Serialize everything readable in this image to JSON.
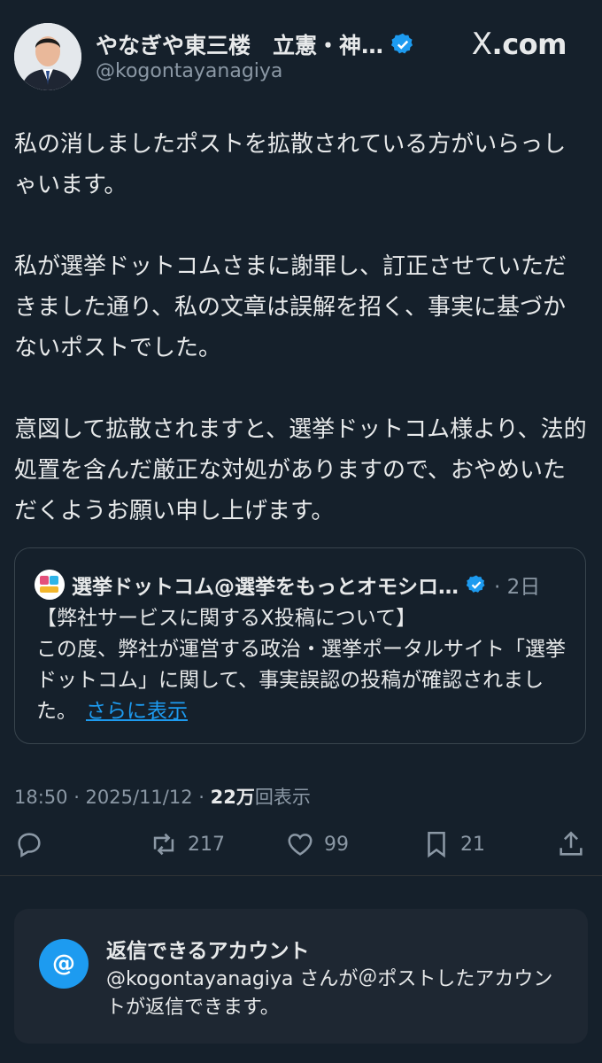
{
  "author": {
    "name": "やなぎや東三楼　立憲・神…",
    "handle": "@kogontayanagiya",
    "verified": true
  },
  "brand": {
    "logo_text": ".com",
    "logo_mark": "X"
  },
  "post": {
    "paragraphs": [
      "私の消しましたポストを拡散されている方がいらっしゃいます。",
      "私が選挙ドットコムさまに謝罪し、訂正させていただきました通り、私の文章は誤解を招く、事実に基づかないポストでした。",
      "意図して拡散されますと、選挙ドットコム様より、法的処置を含んだ厳正な対処がありますので、おやめいただくようお願い申し上げます。"
    ]
  },
  "quote": {
    "name": "選挙ドットコム@選挙をもっとオモシロ…",
    "date": "· 2日",
    "text": "【弊社サービスに関するX投稿について】\nこの度、弊社が運営する政治・選挙ポータルサイト「選挙ドットコム」に関して、事実誤認の投稿が確認されました。",
    "more": "さらに表示"
  },
  "meta": {
    "time": "18:50 · 2025/11/12 · ",
    "views_count": "22万",
    "views_label": "回表示"
  },
  "actions": {
    "reposts": "217",
    "likes": "99",
    "bookmarks": "21"
  },
  "reply_settings": {
    "title": "返信できるアカウント",
    "description": "@kogontayanagiya さんが＠ポストしたアカウントが返信できます。",
    "icon": "@"
  },
  "colors": {
    "background": "#15202b",
    "accent": "#1d9bf0",
    "muted": "#8b98a5"
  }
}
